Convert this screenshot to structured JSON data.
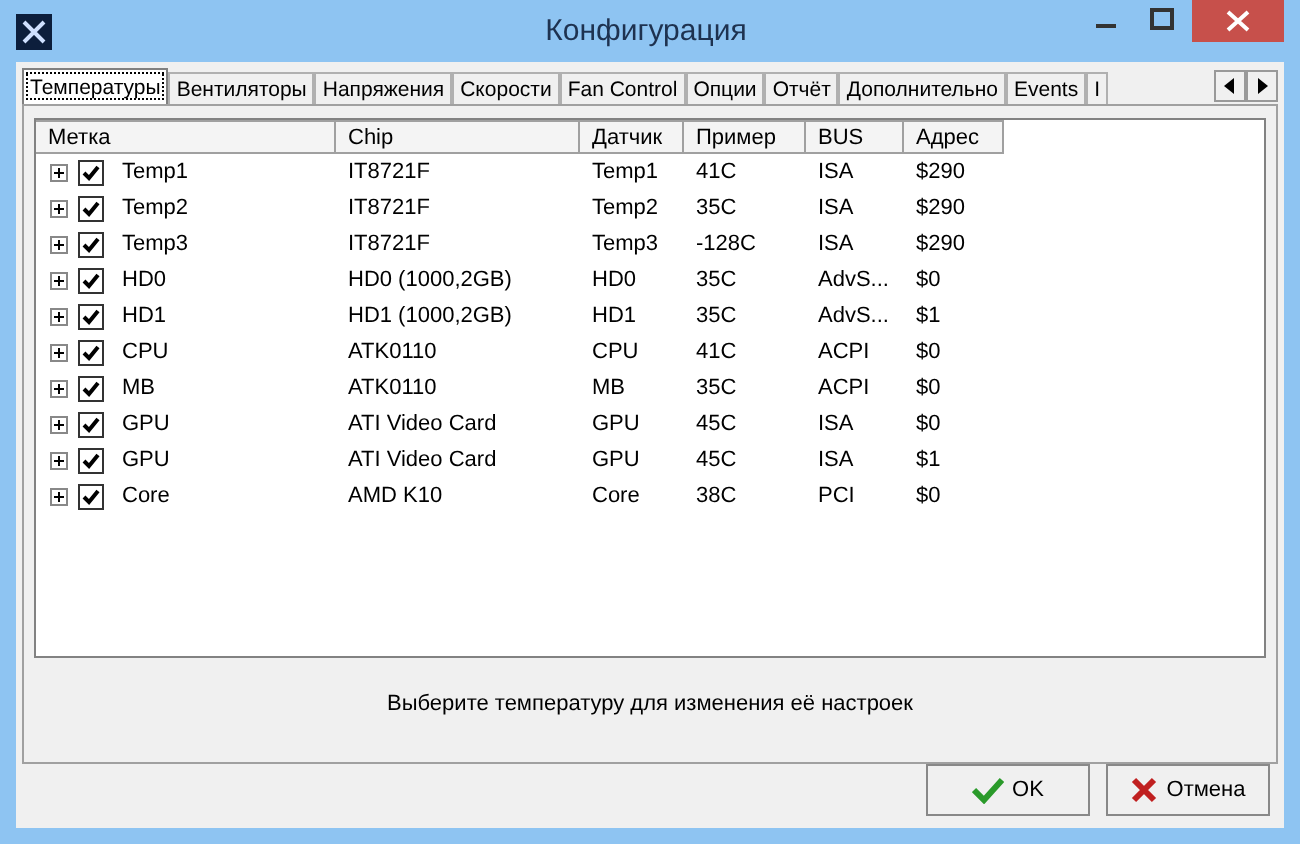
{
  "window": {
    "title": "Конфигурация"
  },
  "tabs": [
    {
      "label": "Температуры",
      "selected": true
    },
    {
      "label": "Вентиляторы",
      "selected": false
    },
    {
      "label": "Напряжения",
      "selected": false
    },
    {
      "label": "Скорости",
      "selected": false
    },
    {
      "label": "Fan Control",
      "selected": false
    },
    {
      "label": "Опции",
      "selected": false
    },
    {
      "label": "Отчёт",
      "selected": false
    },
    {
      "label": "Дополнительно",
      "selected": false
    },
    {
      "label": "Events",
      "selected": false
    },
    {
      "label": "I",
      "selected": false
    }
  ],
  "table": {
    "columns": [
      "Метка",
      "Chip",
      "Датчик",
      "Пример",
      "BUS",
      "Адрес"
    ],
    "rows": [
      {
        "checked": true,
        "cells": [
          "Temp1",
          "IT8721F",
          "Temp1",
          "41C",
          "ISA",
          "$290"
        ]
      },
      {
        "checked": true,
        "cells": [
          "Temp2",
          "IT8721F",
          "Temp2",
          "35C",
          "ISA",
          "$290"
        ]
      },
      {
        "checked": true,
        "cells": [
          "Temp3",
          "IT8721F",
          "Temp3",
          "-128C",
          "ISA",
          "$290"
        ]
      },
      {
        "checked": true,
        "cells": [
          "HD0",
          "HD0 (1000,2GB)",
          "HD0",
          "35C",
          "AdvS...",
          "$0"
        ]
      },
      {
        "checked": true,
        "cells": [
          "HD1",
          "HD1 (1000,2GB)",
          "HD1",
          "35C",
          "AdvS...",
          "$1"
        ]
      },
      {
        "checked": true,
        "cells": [
          "CPU",
          "ATK0110",
          "CPU",
          "41C",
          "ACPI",
          "$0"
        ]
      },
      {
        "checked": true,
        "cells": [
          "MB",
          "ATK0110",
          "MB",
          "35C",
          "ACPI",
          "$0"
        ]
      },
      {
        "checked": true,
        "cells": [
          "GPU",
          "ATI Video Card",
          "GPU",
          "45C",
          "ISA",
          "$0"
        ]
      },
      {
        "checked": true,
        "cells": [
          "GPU",
          "ATI Video Card",
          "GPU",
          "45C",
          "ISA",
          "$1"
        ]
      },
      {
        "checked": true,
        "cells": [
          "Core",
          "AMD K10",
          "Core",
          "38C",
          "PCI",
          "$0"
        ]
      }
    ]
  },
  "hint": "Выберите температуру для изменения её настроек",
  "buttons": [
    {
      "label": "OK",
      "kind": "ok"
    },
    {
      "label": "Отмена",
      "kind": "cancel"
    }
  ]
}
